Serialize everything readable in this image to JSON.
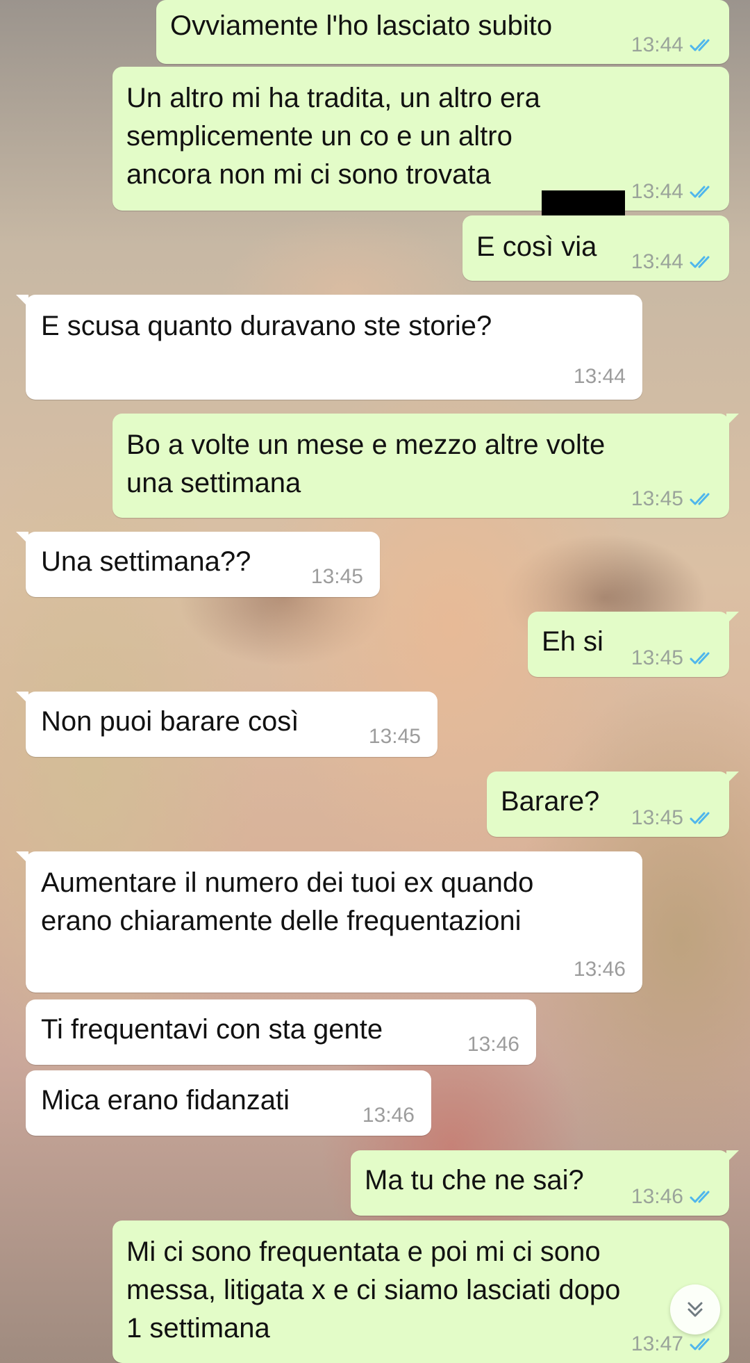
{
  "messages": [
    {
      "text": "Ovviamente l'ho lasciato subito",
      "time": "13:44",
      "side": "out",
      "status": "read"
    },
    {
      "text": "Un altro mi ha tradita, un altro era\nsemplicemente un co        e un altro\nancora non mi ci sono trovata",
      "time": "13:44",
      "side": "out",
      "status": "read"
    },
    {
      "text": "E così via",
      "time": "13:44",
      "side": "out",
      "status": "read"
    },
    {
      "text": "E scusa quanto duravano ste storie?",
      "time": "13:44",
      "side": "in"
    },
    {
      "text": "Bo a volte un mese e mezzo altre volte\nuna settimana",
      "time": "13:45",
      "side": "out",
      "status": "read"
    },
    {
      "text": "Una settimana??",
      "time": "13:45",
      "side": "in"
    },
    {
      "text": "Eh si",
      "time": "13:45",
      "side": "out",
      "status": "read"
    },
    {
      "text": "Non puoi barare così",
      "time": "13:45",
      "side": "in"
    },
    {
      "text": "Barare?",
      "time": "13:45",
      "side": "out",
      "status": "read"
    },
    {
      "text": "Aumentare il numero dei tuoi ex quando\nerano chiaramente delle frequentazioni",
      "time": "13:46",
      "side": "in"
    },
    {
      "text": "Ti frequentavi con sta gente",
      "time": "13:46",
      "side": "in"
    },
    {
      "text": "Mica erano fidanzati",
      "time": "13:46",
      "side": "in"
    },
    {
      "text": "Ma tu che ne sai?",
      "time": "13:46",
      "side": "out",
      "status": "read"
    },
    {
      "text": "Mi ci sono frequentata e poi mi ci sono\nmessa, litigata x e ci siamo lasciati dopo\n1 settimana",
      "time": "13:47",
      "side": "out",
      "status": "read"
    }
  ],
  "colors": {
    "outgoing_bubble": "#e3fcc8",
    "incoming_bubble": "#ffffff",
    "read_tick": "#4fb6ec",
    "timestamp": "#9aa39a"
  },
  "icons": {
    "scroll_down": "double-chevron-down-icon"
  }
}
